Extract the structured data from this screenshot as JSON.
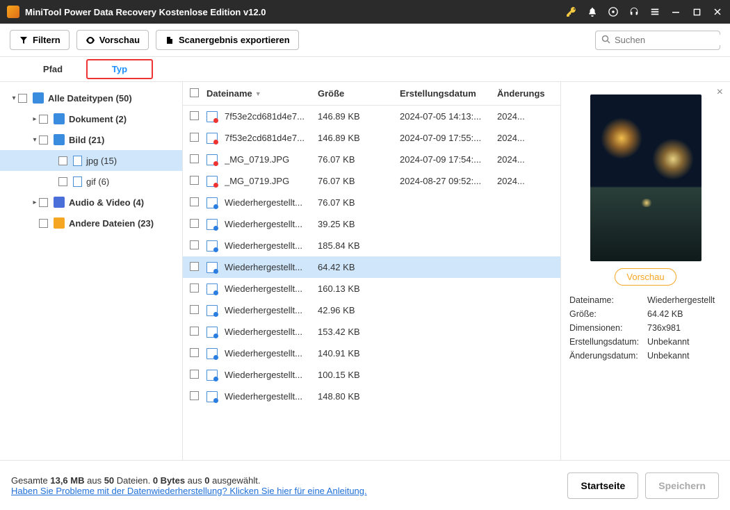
{
  "title": "MiniTool Power Data Recovery Kostenlose Edition v12.0",
  "toolbar": {
    "filter": "Filtern",
    "preview": "Vorschau",
    "export": "Scanergebnis exportieren"
  },
  "search": {
    "placeholder": "Suchen"
  },
  "tabs": {
    "path": "Pfad",
    "type": "Typ"
  },
  "tree": {
    "all": "Alle Dateitypen (50)",
    "doc": "Dokument (2)",
    "img": "Bild (21)",
    "jpg": "jpg (15)",
    "gif": "gif (6)",
    "av": "Audio & Video (4)",
    "oth": "Andere Dateien (23)"
  },
  "cols": {
    "name": "Dateiname",
    "size": "Größe",
    "created": "Erstellungsdatum",
    "modified": "Änderungs"
  },
  "files": [
    {
      "name": "7f53e2cd681d4e7...",
      "size": "146.89 KB",
      "cr": "2024-07-05 14:13:...",
      "mod": "2024...",
      "rec": false
    },
    {
      "name": "7f53e2cd681d4e7...",
      "size": "146.89 KB",
      "cr": "2024-07-09 17:55:...",
      "mod": "2024...",
      "rec": false
    },
    {
      "name": "_MG_0719.JPG",
      "size": "76.07 KB",
      "cr": "2024-07-09 17:54:...",
      "mod": "2024...",
      "rec": false
    },
    {
      "name": "_MG_0719.JPG",
      "size": "76.07 KB",
      "cr": "2024-08-27 09:52:...",
      "mod": "2024...",
      "rec": false
    },
    {
      "name": "Wiederhergestellt...",
      "size": "76.07 KB",
      "cr": "",
      "mod": "",
      "rec": true
    },
    {
      "name": "Wiederhergestellt...",
      "size": "39.25 KB",
      "cr": "",
      "mod": "",
      "rec": true
    },
    {
      "name": "Wiederhergestellt...",
      "size": "185.84 KB",
      "cr": "",
      "mod": "",
      "rec": true
    },
    {
      "name": "Wiederhergestellt...",
      "size": "64.42 KB",
      "cr": "",
      "mod": "",
      "rec": true,
      "sel": true
    },
    {
      "name": "Wiederhergestellt...",
      "size": "160.13 KB",
      "cr": "",
      "mod": "",
      "rec": true
    },
    {
      "name": "Wiederhergestellt...",
      "size": "42.96 KB",
      "cr": "",
      "mod": "",
      "rec": true
    },
    {
      "name": "Wiederhergestellt...",
      "size": "153.42 KB",
      "cr": "",
      "mod": "",
      "rec": true
    },
    {
      "name": "Wiederhergestellt...",
      "size": "140.91 KB",
      "cr": "",
      "mod": "",
      "rec": true
    },
    {
      "name": "Wiederhergestellt...",
      "size": "100.15 KB",
      "cr": "",
      "mod": "",
      "rec": true
    },
    {
      "name": "Wiederhergestellt...",
      "size": "148.80 KB",
      "cr": "",
      "mod": "",
      "rec": true
    }
  ],
  "preview": {
    "btn": "Vorschau",
    "k_name": "Dateiname:",
    "v_name": "Wiederhergestellt",
    "k_size": "Größe:",
    "v_size": "64.42 KB",
    "k_dim": "Dimensionen:",
    "v_dim": "736x981",
    "k_cr": "Erstellungsdatum:",
    "v_cr": "Unbekannt",
    "k_mod": "Änderungsdatum:",
    "v_mod": "Unbekannt"
  },
  "footer": {
    "l1a": "Gesamte ",
    "l1b": "13,6 MB",
    "l1c": " aus ",
    "l1d": "50",
    "l1e": " Dateien.  ",
    "l1f": "0 Bytes",
    "l1g": " aus ",
    "l1h": "0",
    "l1i": " ausgewählt.",
    "help": "Haben Sie Probleme mit der Datenwiederherstellung? Klicken Sie hier für eine Anleitung.",
    "home": "Startseite",
    "save": "Speichern"
  }
}
